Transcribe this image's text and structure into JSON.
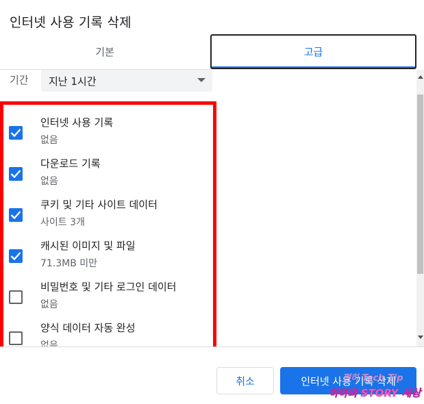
{
  "dialog": {
    "title": "인터넷 사용 기록 삭제"
  },
  "tabs": [
    {
      "label": "기본",
      "selected": false
    },
    {
      "label": "고급",
      "selected": true
    }
  ],
  "time_range": {
    "label": "기간",
    "value": "지난 1시간"
  },
  "items": [
    {
      "label": "인터넷 사용 기록",
      "sub": "없음",
      "checked": true
    },
    {
      "label": "다운로드 기록",
      "sub": "없음",
      "checked": true
    },
    {
      "label": "쿠키 및 기타 사이트 데이터",
      "sub": "사이트 3개",
      "checked": true
    },
    {
      "label": "캐시된 이미지 및 파일",
      "sub": "71.3MB 미만",
      "checked": true
    },
    {
      "label": "비밀번호 및 기타 로그인 데이터",
      "sub": "없음",
      "checked": false
    },
    {
      "label": "양식 데이터 자동 완성",
      "sub": "없음",
      "checked": false
    }
  ],
  "buttons": {
    "cancel": "취소",
    "delete": "인터넷 사용 기록 삭제"
  },
  "watermark": {
    "line1": "쩡하 Tech Tip",
    "line2": "하하의 STORY 세상"
  },
  "colors": {
    "accent": "#1a73e8",
    "highlight": "#ff0000"
  }
}
